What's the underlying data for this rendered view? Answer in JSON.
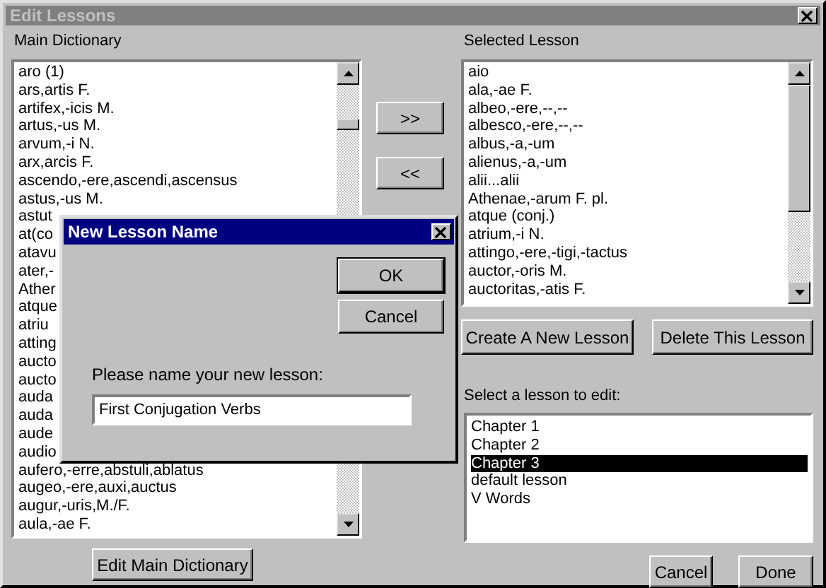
{
  "window": {
    "title": "Edit Lessons"
  },
  "main_dictionary": {
    "label": "Main Dictionary",
    "items": [
      "aro (1)",
      "ars,artis F.",
      "artifex,-icis M.",
      "artus,-us M.",
      "arvum,-i N.",
      "arx,arcis F.",
      "ascendo,-ere,ascendi,ascensus",
      "astus,-us M.",
      "astut",
      "at(co",
      "atavu",
      "ater,-",
      "Ather",
      "atque",
      "atriu",
      "atting",
      "aucto",
      "aucto",
      "auda",
      "auda",
      "aude",
      "audio",
      "aufero,-erre,abstuli,ablatus",
      "augeo,-ere,auxi,auctus",
      "augur,-uris,M./F.",
      "aula,-ae F."
    ]
  },
  "move_buttons": [
    ">>",
    "<<"
  ],
  "selected_lesson": {
    "label": "Selected Lesson",
    "items": [
      "aio",
      "ala,-ae F.",
      "albeo,-ere,--,--",
      "albesco,-ere,--,--",
      "albus,-a,-um",
      "alienus,-a,-um",
      "alii...alii",
      "Athenae,-arum F. pl.",
      "atque (conj.)",
      "atrium,-i N.",
      "attingo,-ere,-tigi,-tactus",
      "auctor,-oris M.",
      "auctoritas,-atis F."
    ]
  },
  "lesson_buttons": [
    "Create A New Lesson",
    "Delete This Lesson"
  ],
  "lesson_picker": {
    "label": "Select a lesson to edit:",
    "items": [
      {
        "label": "Chapter 1",
        "selected": false
      },
      {
        "label": "Chapter 2",
        "selected": false
      },
      {
        "label": "Chapter 3",
        "selected": true
      },
      {
        "label": "default lesson",
        "selected": false
      },
      {
        "label": "V Words",
        "selected": false
      }
    ]
  },
  "edit_dictionary_button": "Edit Main Dictionary",
  "footer_buttons": [
    "Cancel",
    "Done"
  ],
  "dialog": {
    "title": "New Lesson Name",
    "buttons": [
      "OK",
      "Cancel"
    ],
    "prompt": "Please name your new lesson:",
    "value": "First Conjugation Verbs"
  }
}
